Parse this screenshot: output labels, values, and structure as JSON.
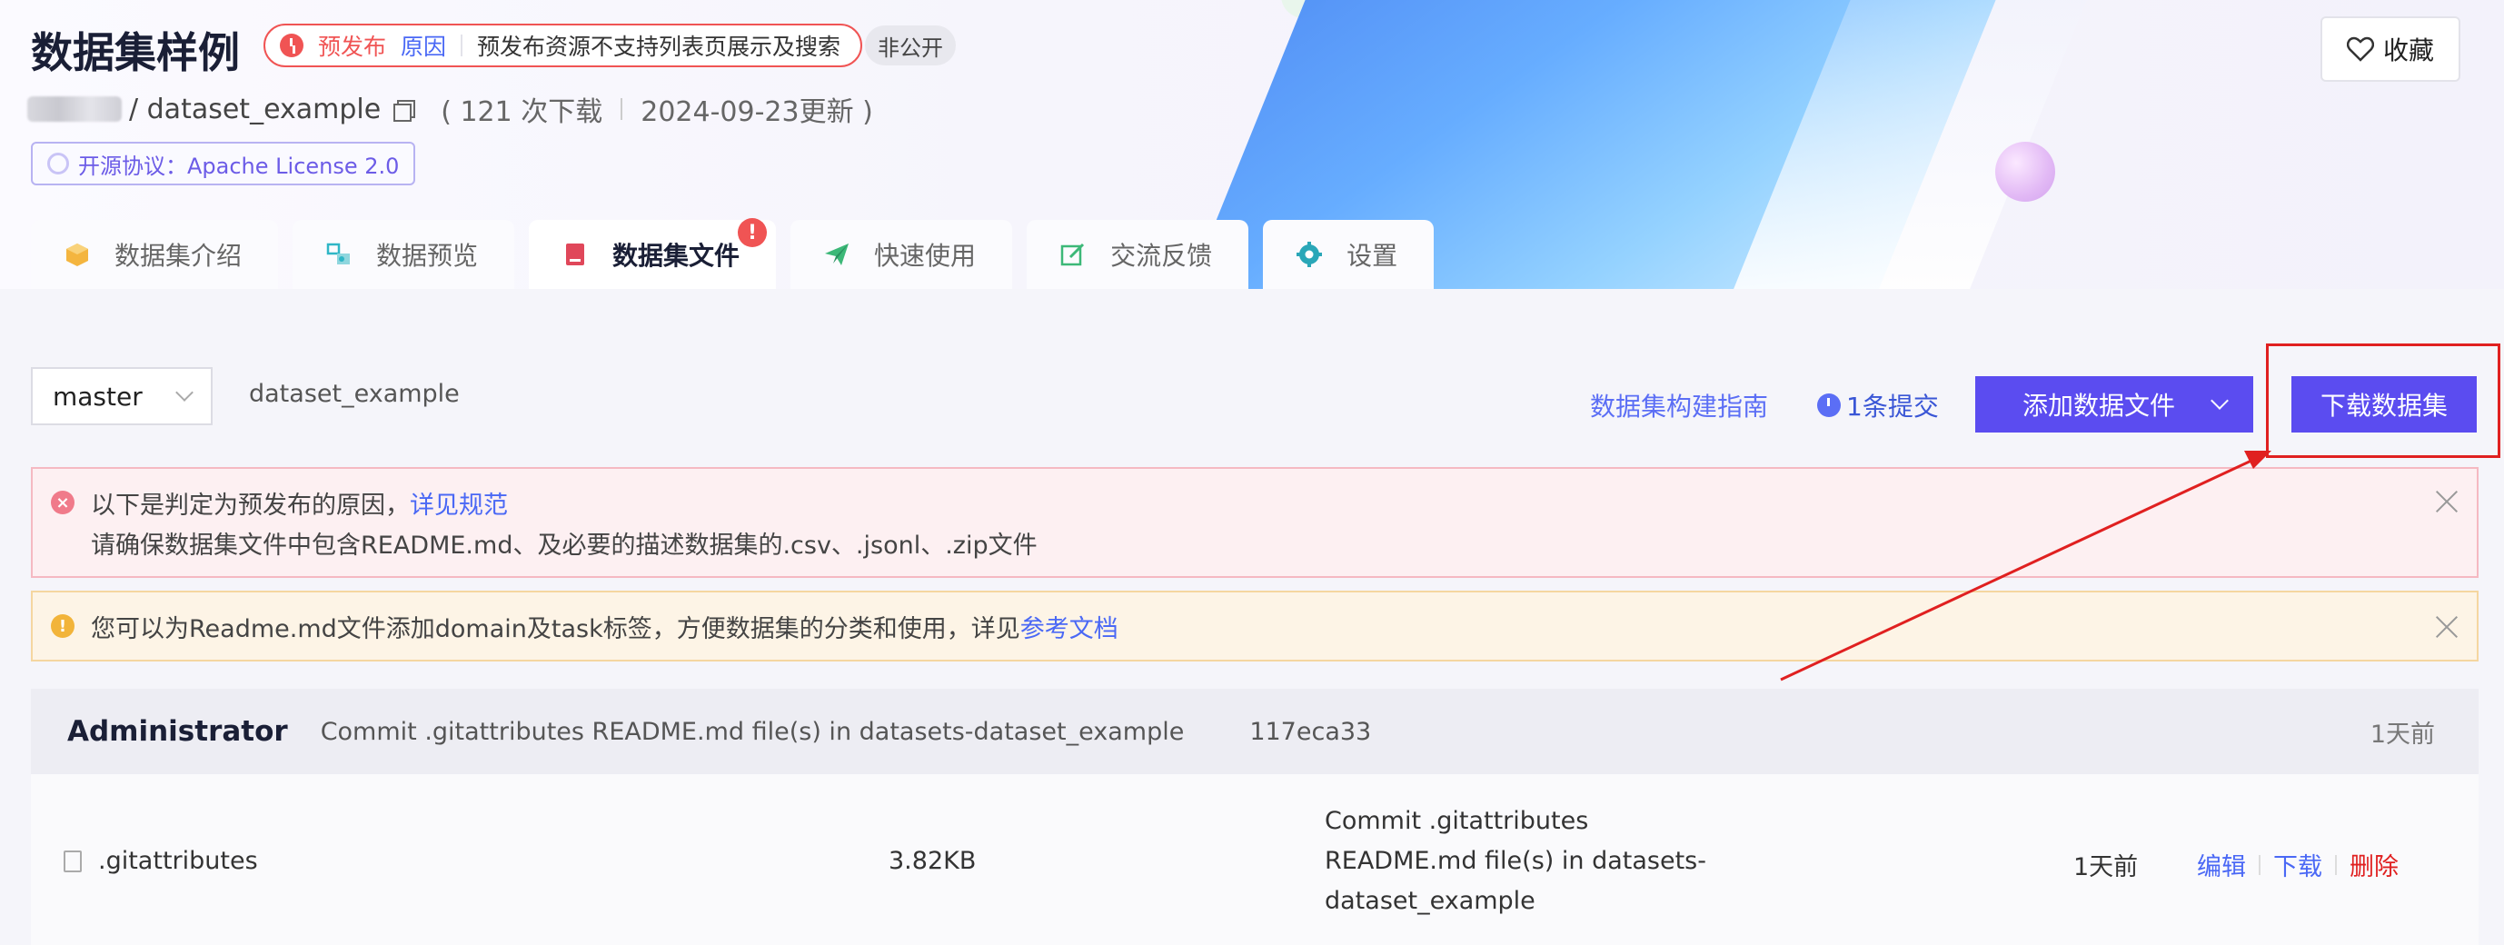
{
  "header": {
    "title": "数据集样例",
    "status": {
      "label": "预发布",
      "reason": "原因",
      "description": "预发布资源不支持列表页展示及搜索"
    },
    "visibility": "非公开",
    "favorite_label": "收藏",
    "repo_path": "/ dataset_example",
    "downloads": "( 121 次下载",
    "updated": "2024-09-23更新 )",
    "license": "开源协议：Apache License 2.0"
  },
  "tabs": [
    {
      "label": "数据集介绍",
      "icon": "box-icon"
    },
    {
      "label": "数据预览",
      "icon": "preview-icon"
    },
    {
      "label": "数据集文件",
      "icon": "book-icon",
      "badge": "!"
    },
    {
      "label": "快速使用",
      "icon": "paper-plane-icon"
    },
    {
      "label": "交流反馈",
      "icon": "edit-icon"
    },
    {
      "label": "设置",
      "icon": "gear-icon"
    }
  ],
  "toolbar": {
    "branch": "master",
    "path": "dataset_example",
    "guide_link": "数据集构建指南",
    "commits": "1条提交",
    "add_file_label": "添加数据文件",
    "download_label": "下载数据集"
  },
  "alerts": {
    "red_line1": "以下是判定为预发布的原因，",
    "red_link": "详见规范",
    "red_line2": "请确保数据集文件中包含README.md、及必要的描述数据集的.csv、.jsonl、.zip文件",
    "yellow_text": "您可以为Readme.md文件添加domain及task标签，方便数据集的分类和使用，详见",
    "yellow_link": "参考文档"
  },
  "commit": {
    "author": "Administrator",
    "message": "Commit .gitattributes README.md file(s) in datasets-dataset_example",
    "hash": "117eca33",
    "time": "1天前"
  },
  "files": [
    {
      "name": ".gitattributes",
      "size": "3.82KB",
      "message_l1": "Commit .gitattributes",
      "message_l2": "README.md file(s) in datasets-",
      "message_l3": "dataset_example",
      "time": "1天前",
      "actions": {
        "edit": "编辑",
        "download": "下载",
        "delete": "删除"
      }
    }
  ],
  "colors": {
    "primary": "#5b4cf0",
    "danger": "#e02020",
    "link": "#4a68f5"
  }
}
